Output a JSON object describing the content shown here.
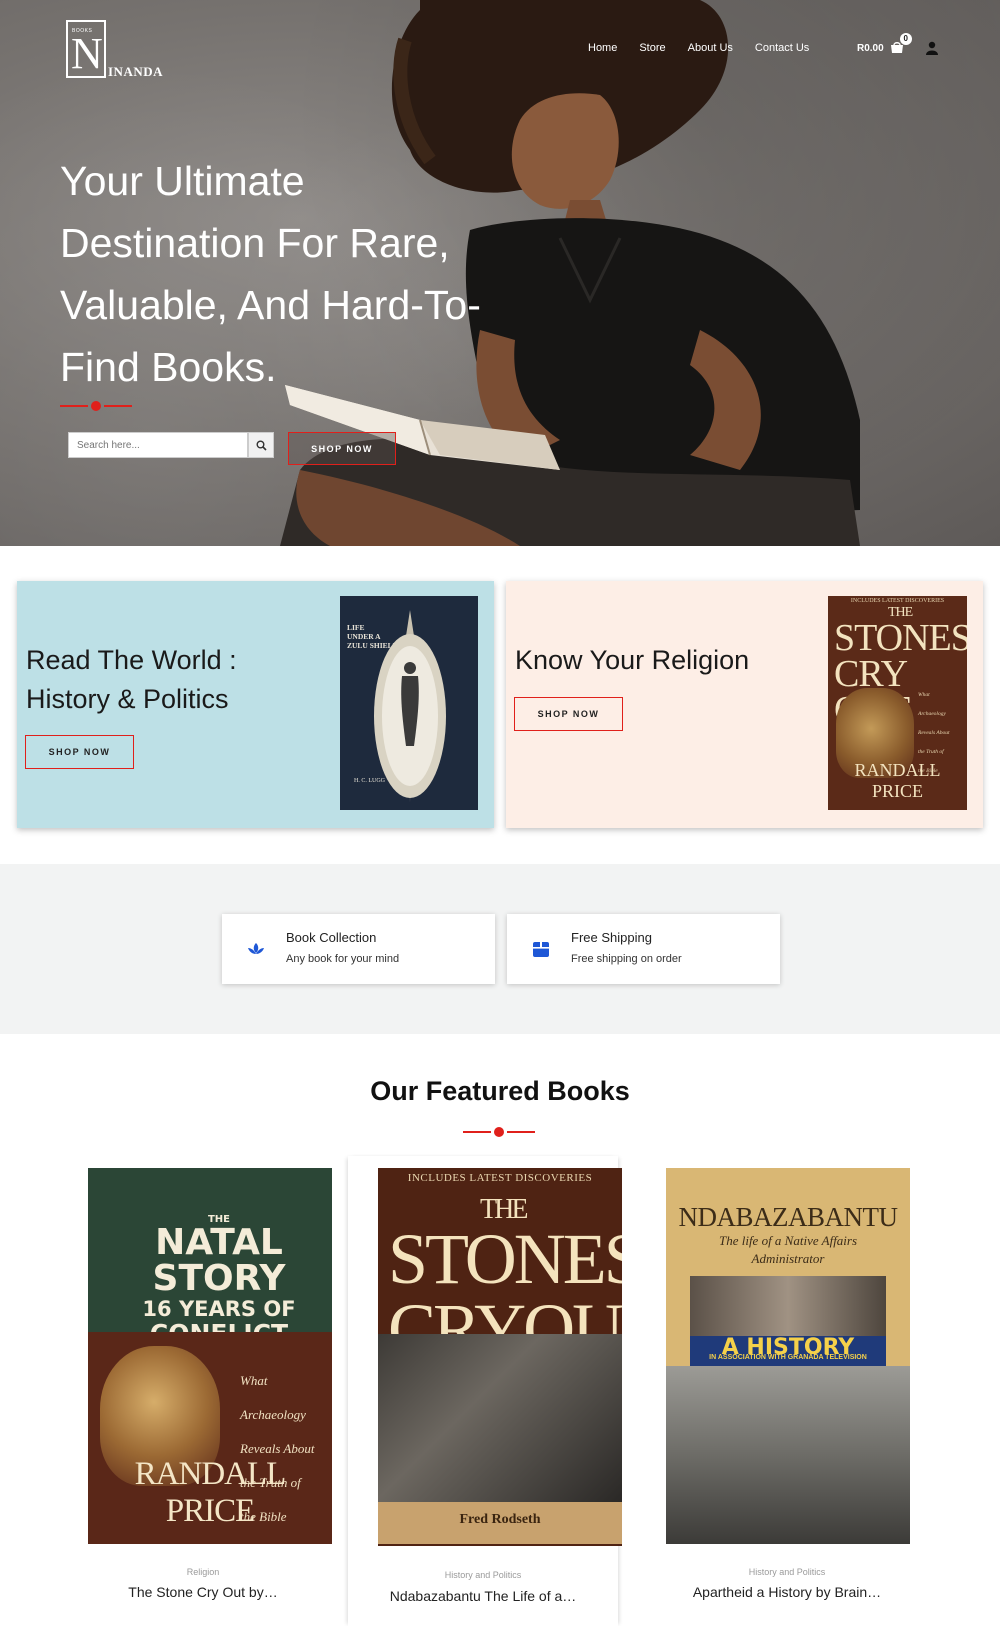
{
  "brand": {
    "logo_small": "BOOKS",
    "logo_letter": "N",
    "logo_word": "INANDA"
  },
  "nav": {
    "items": [
      "Home",
      "Store",
      "About Us",
      "Contact Us"
    ]
  },
  "cart": {
    "total": "R0.00",
    "count": "0"
  },
  "hero": {
    "title_lines": [
      "Your Ultimate",
      "Destination For Rare,",
      "Valuable, And Hard-To-",
      "Find Books."
    ],
    "search_placeholder": "Search here...",
    "shop_label": "SHOP NOW"
  },
  "promos": [
    {
      "title_lines": [
        "Read The World :",
        "History & Politics"
      ],
      "shop_label": "SHOP NOW",
      "book": {
        "title_lines": [
          "LIFE",
          "UNDER A",
          "ZULU SHIELD"
        ],
        "author": "H. C. LUGG"
      }
    },
    {
      "title_lines": [
        "Know Your Religion"
      ],
      "shop_label": "SHOP NOW",
      "book": {
        "top": "INCLUDES LATEST DISCOVERIES",
        "title_lines": [
          "THE",
          "STONES",
          "CRY OUT"
        ],
        "side": [
          "What",
          "Archaeology",
          "Reveals About",
          "the Truth of",
          "the Bible"
        ],
        "author": "RANDALL PRICE"
      }
    }
  ],
  "features": [
    {
      "title": "Book Collection",
      "subtitle": "Any book for your mind",
      "icon": "lotus-icon"
    },
    {
      "title": "Free Shipping",
      "subtitle": "Free shipping on order",
      "icon": "box-icon"
    }
  ],
  "featured": {
    "heading": "Our Featured Books",
    "products": [
      {
        "category": "Religion",
        "name": "The Stone Cry Out by…",
        "cover": {
          "small": "THE",
          "lines": [
            "NATAL",
            "STORY",
            "16 YEARS OF",
            "CONFLICT"
          ],
          "side": [
            "What",
            "Archaeology",
            "Reveals About",
            "the Truth of",
            "the Bible"
          ],
          "author": "RANDALL PRICE"
        }
      },
      {
        "category": "History and Politics",
        "name": "Ndabazabantu The Life of a…",
        "cover": {
          "top": "INCLUDES LATEST DISCOVERIES",
          "lines": [
            "THE",
            "STONES",
            "CRYOUT"
          ],
          "author": "Fred Rodseth"
        }
      },
      {
        "category": "History and Politics",
        "name": "Apartheid a History by Brain…",
        "cover": {
          "title": "NDABAZABANTU",
          "subtitle_lines": [
            "The life of a Native Affairs",
            "Administrator"
          ],
          "band": "A HISTORY",
          "assoc": "IN ASSOCIATION WITH GRANADA TELEVISION"
        }
      }
    ]
  },
  "colors": {
    "accent": "#e0201b",
    "promo1_bg": "#bde0e6",
    "promo2_bg": "#fdeee6",
    "icon_blue": "#1e57d6",
    "band_bg": "#f2f3f3"
  }
}
